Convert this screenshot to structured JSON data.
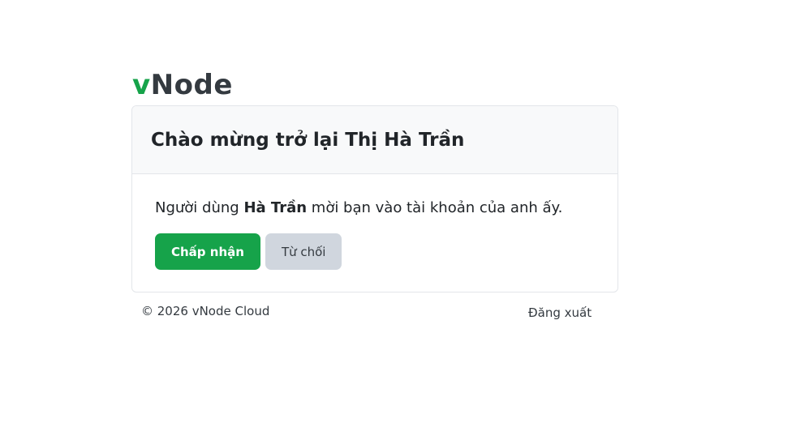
{
  "brand": {
    "logo_first": "v",
    "logo_rest": "Node"
  },
  "card": {
    "title": "Chào mừng trở lại Thị Hà Trần",
    "message_prefix": "Người dùng ",
    "inviter_name": "Hà Trần",
    "message_suffix": " mời bạn vào tài khoản của anh ấy.",
    "accept_label": "Chấp nhận",
    "decline_label": "Từ chối"
  },
  "footer": {
    "copyright": "© 2026 vNode Cloud",
    "logout_label": "Đăng xuất"
  },
  "colors": {
    "accent": "#16a34a",
    "decline_bg": "#d0d6de",
    "header_bg": "#f8f9fa"
  }
}
